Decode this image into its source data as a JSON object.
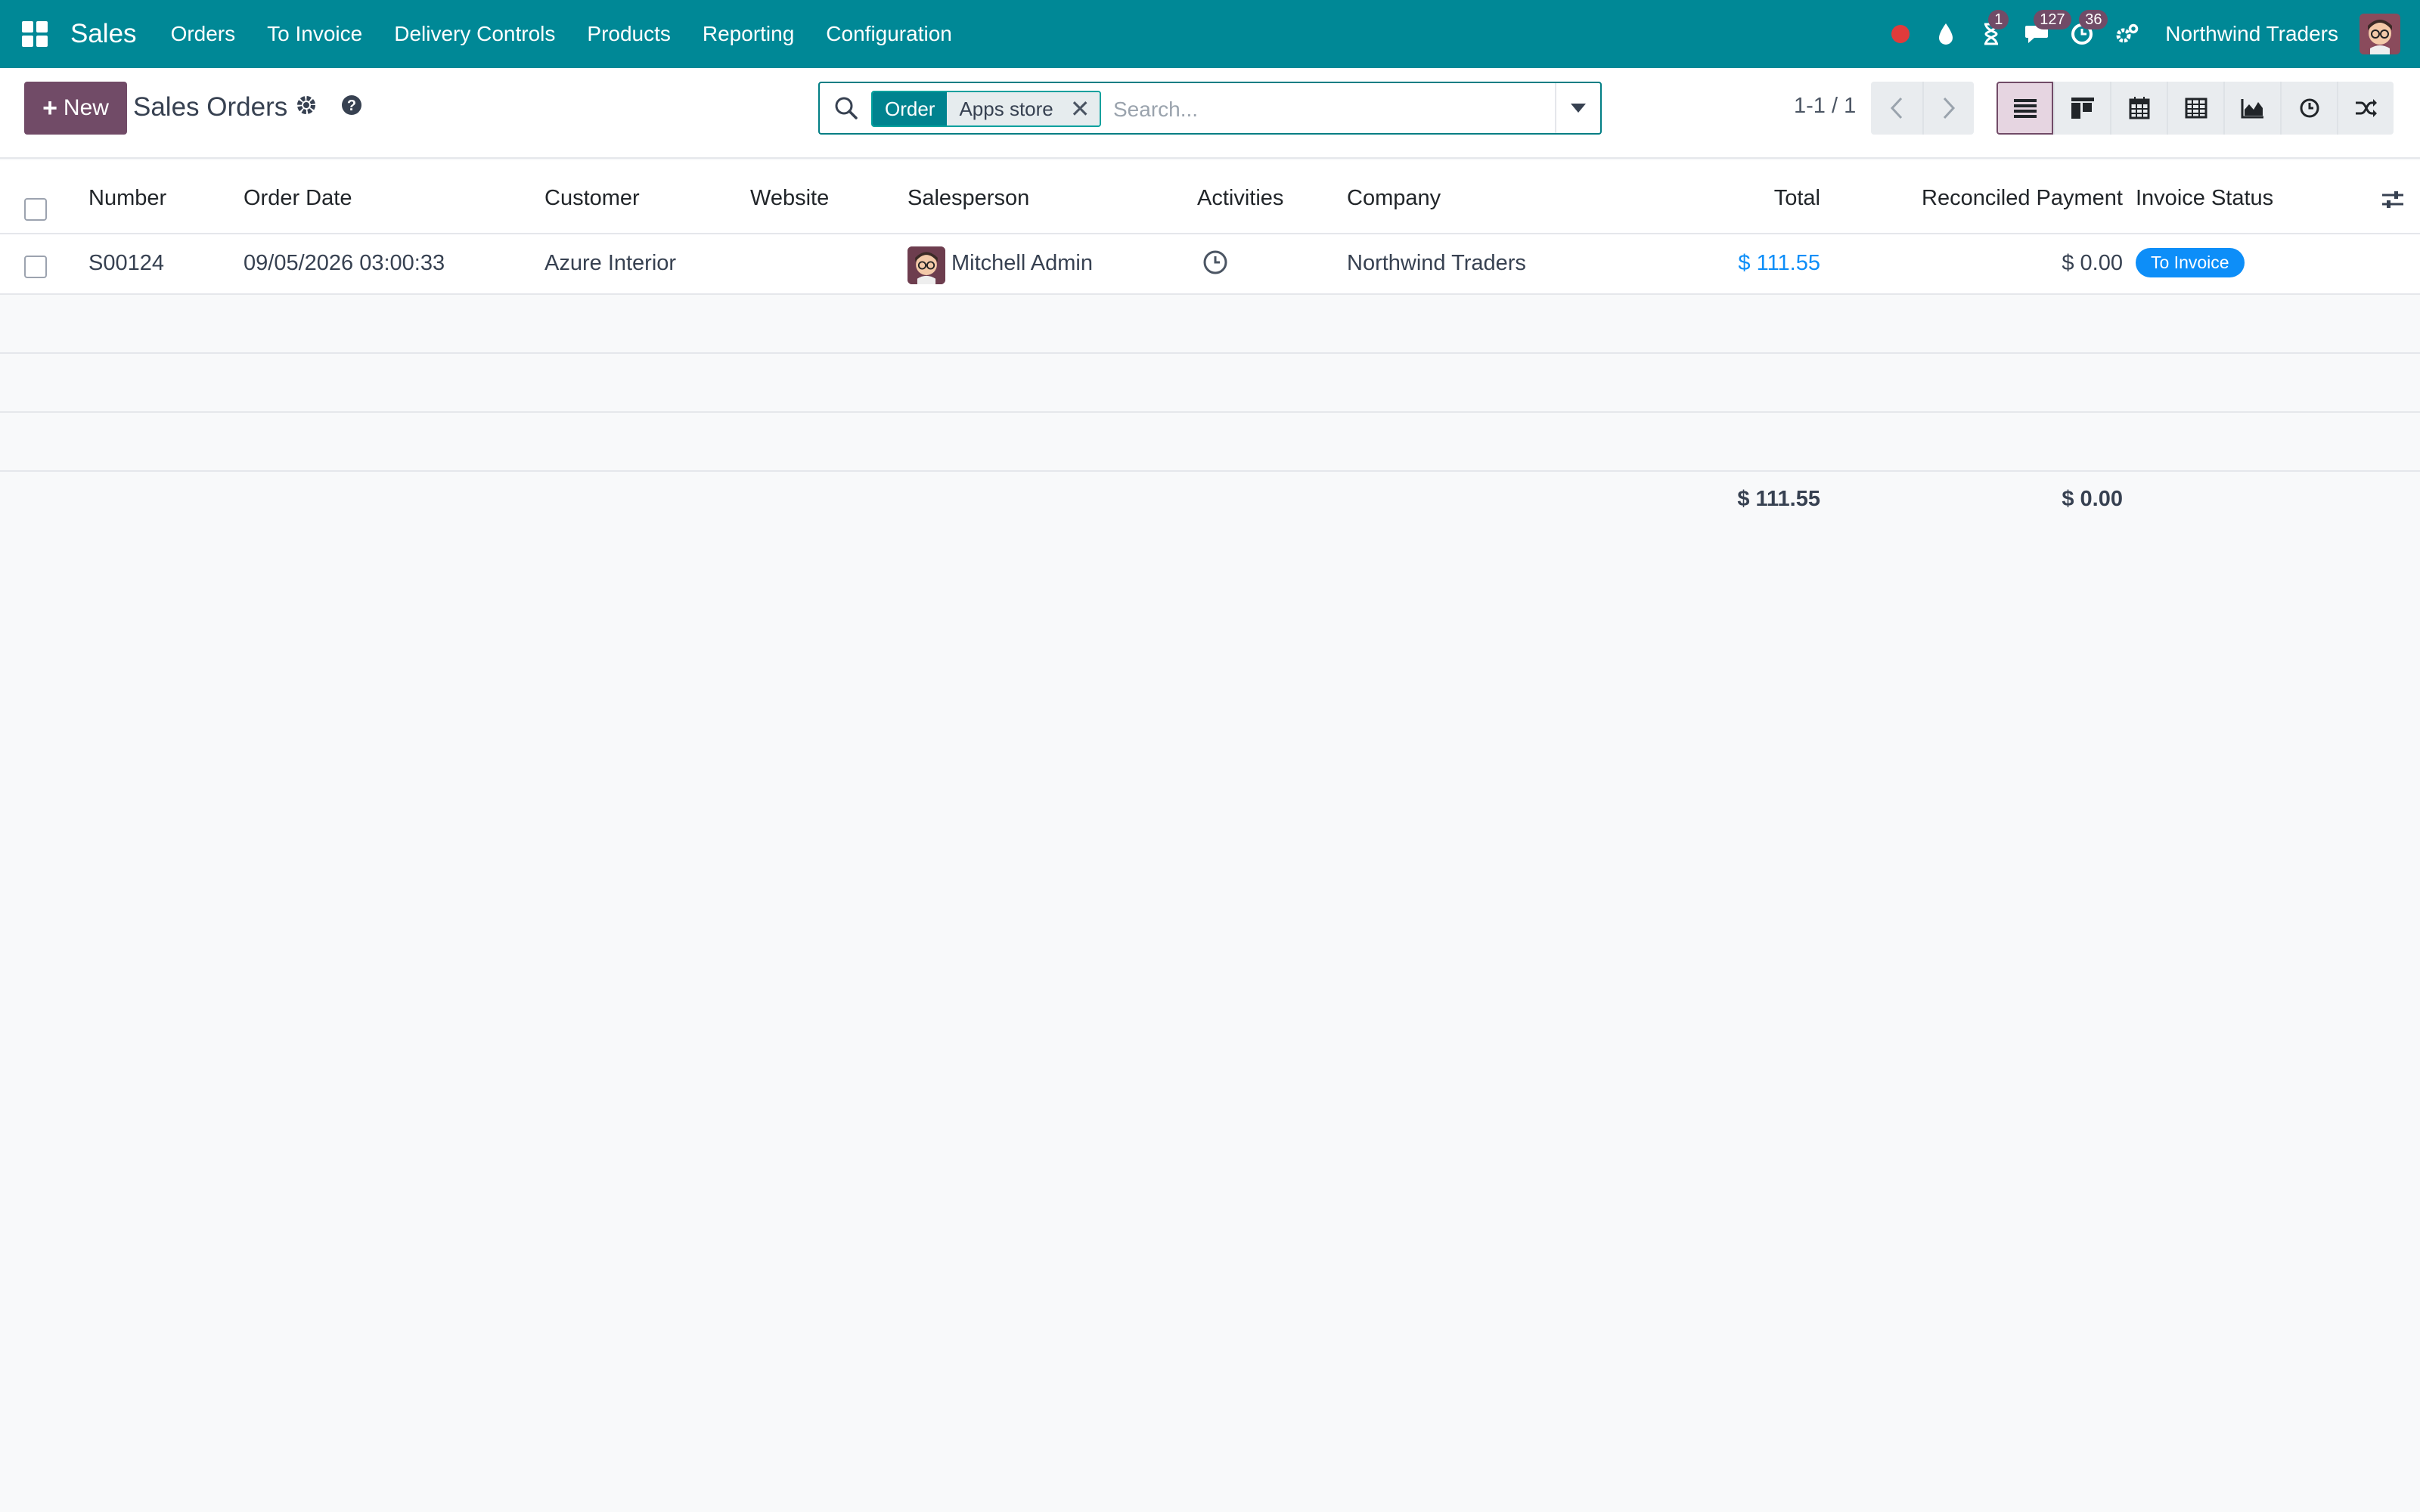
{
  "navbar": {
    "app_name": "Sales",
    "menu": [
      "Orders",
      "To Invoice",
      "Delivery Controls",
      "Products",
      "Reporting",
      "Configuration"
    ],
    "badges": {
      "activities": "1",
      "messages": "127",
      "timesheets": "36"
    },
    "company": "Northwind Traders",
    "colors": {
      "bar": "#008896",
      "badge": "#714B67",
      "record_dot": "#e03b3b"
    }
  },
  "control_panel": {
    "new_label": "New",
    "title": "Sales Orders",
    "search": {
      "facet_label": "Order",
      "facet_value": "Apps store",
      "placeholder": "Search..."
    },
    "pager": "1-1 / 1",
    "views": [
      "list-icon",
      "kanban-icon",
      "calendar-icon",
      "pivot-icon",
      "graph-icon",
      "activity-icon",
      "map-icon"
    ],
    "active_view": "list-icon"
  },
  "table": {
    "columns": {
      "number": "Number",
      "order_date": "Order Date",
      "customer": "Customer",
      "website": "Website",
      "salesperson": "Salesperson",
      "activities": "Activities",
      "company": "Company",
      "total": "Total",
      "reconciled": "Reconciled Payment",
      "invoice_status": "Invoice Status"
    },
    "rows": [
      {
        "number": "S00124",
        "order_date": "09/05/2026 03:00:33",
        "customer": "Azure Interior",
        "website": "",
        "salesperson": "Mitchell Admin",
        "activity_icon": "clock-icon",
        "company": "Northwind Traders",
        "total": "$ 111.55",
        "reconciled": "$ 0.00",
        "invoice_status": "To Invoice"
      }
    ],
    "totals": {
      "total": "$ 111.55",
      "reconciled": "$ 0.00"
    }
  }
}
